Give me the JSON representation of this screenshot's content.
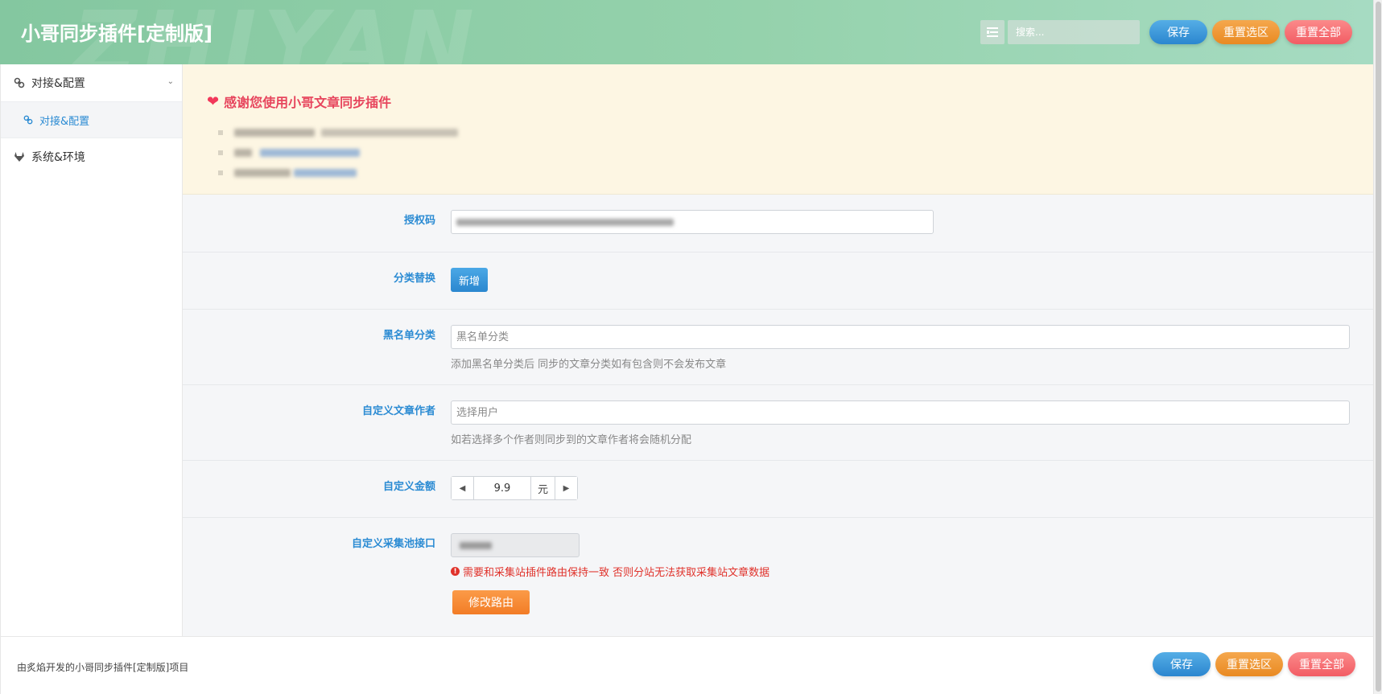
{
  "header": {
    "title": "小哥同步插件[定制版]",
    "watermark": "ZHIYAN",
    "search_placeholder": "搜索...",
    "save_label": "保存",
    "reset_section_label": "重置选区",
    "reset_all_label": "重置全部"
  },
  "sidebar": {
    "items": [
      {
        "label": "对接&配置",
        "icon": "link-icon",
        "expanded": true
      },
      {
        "label": "对接&配置",
        "icon": "link-icon",
        "active": true
      },
      {
        "label": "系统&环境",
        "icon": "gitlab-icon"
      }
    ]
  },
  "notice": {
    "title": "感谢您使用小哥文章同步插件"
  },
  "form": {
    "license": {
      "label": "授权码"
    },
    "category_replace": {
      "label": "分类替换",
      "button": "新增"
    },
    "blacklist": {
      "label": "黑名单分类",
      "placeholder": "黑名单分类",
      "hint": "添加黑名单分类后 同步的文章分类如有包含则不会发布文章"
    },
    "author": {
      "label": "自定义文章作者",
      "placeholder": "选择用户",
      "hint": "如若选择多个作者则同步到的文章作者将会随机分配"
    },
    "amount": {
      "label": "自定义金额",
      "value": "9.9",
      "unit": "元"
    },
    "pool_api": {
      "label": "自定义采集池接口",
      "warning": "需要和采集站插件路由保持一致 否则分站无法获取采集站文章数据",
      "button": "修改路由"
    }
  },
  "footer": {
    "text": "由炙焰开发的小哥同步插件[定制版]项目",
    "save_label": "保存",
    "reset_section_label": "重置选区",
    "reset_all_label": "重置全部"
  },
  "colors": {
    "accent_blue": "#2b8bd3",
    "header_green": "#84c7a0",
    "warning_red": "#e0322b",
    "notice_bg": "#fdf6e3"
  }
}
